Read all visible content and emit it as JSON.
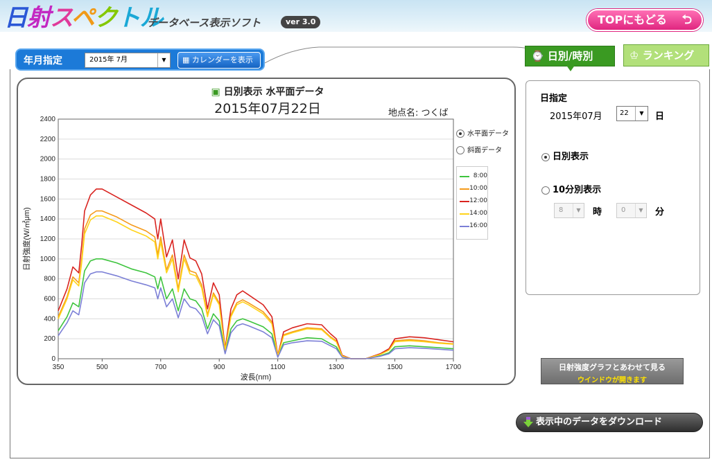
{
  "header": {
    "logo": [
      "日",
      "射",
      "ス",
      "ペ",
      "ク",
      "トル"
    ],
    "subtitle": "データベース表示ソフト",
    "version": "ver 3.0",
    "top_button": "TOPにもどる"
  },
  "year_month": {
    "label": "年月指定",
    "selected": "2015年 7月",
    "calendar_button": "カレンダーを表示"
  },
  "tabs": {
    "daily": "日別/時別",
    "ranking": "ランキング"
  },
  "chart_header": {
    "title": "日別表示 水平面データ",
    "date": "2015年07月22日",
    "location": "地点名: つくば"
  },
  "surface_options": {
    "horizontal": "水平面データ",
    "inclined": "斜面データ"
  },
  "right_panel": {
    "title": "日指定",
    "year_month": "2015年07月",
    "day_value": "22",
    "day_unit": "日",
    "daily_option": "日別表示",
    "ten_min_option": "10分別表示",
    "hour_value": "8",
    "hour_unit": "時",
    "minute_value": "0",
    "minute_unit": "分"
  },
  "buttons": {
    "combo_line1": "日射強度グラフとあわせて見る",
    "combo_line2": "ウインドウが開きます",
    "download": "表示中のデータをダウンロード"
  },
  "chart_data": {
    "type": "line",
    "xlabel": "波長(nm)",
    "ylabel": "日射強度(W/㎡μm)",
    "xlim": [
      350,
      1700
    ],
    "ylim": [
      0,
      2400
    ],
    "x_ticks": [
      350,
      500,
      700,
      900,
      1100,
      1300,
      1500,
      1700
    ],
    "y_ticks": [
      0,
      200,
      400,
      600,
      800,
      1000,
      1200,
      1400,
      1600,
      1800,
      2000,
      2200,
      2400
    ],
    "grid": "horizontal",
    "x": [
      350,
      380,
      400,
      420,
      430,
      440,
      460,
      480,
      500,
      550,
      600,
      650,
      680,
      690,
      700,
      720,
      740,
      760,
      780,
      800,
      820,
      840,
      860,
      880,
      900,
      920,
      940,
      960,
      980,
      1000,
      1050,
      1080,
      1100,
      1120,
      1150,
      1200,
      1250,
      1280,
      1300,
      1320,
      1350,
      1400,
      1450,
      1480,
      1500,
      1550,
      1600,
      1650,
      1700
    ],
    "series": [
      {
        "name": "8:00",
        "color": "#3dc43d",
        "values": [
          280,
          420,
          560,
          520,
          700,
          880,
          980,
          1000,
          1000,
          960,
          900,
          860,
          820,
          700,
          820,
          600,
          700,
          480,
          700,
          600,
          580,
          500,
          300,
          450,
          380,
          60,
          300,
          380,
          400,
          380,
          320,
          250,
          20,
          160,
          180,
          210,
          200,
          150,
          120,
          20,
          0,
          0,
          30,
          60,
          120,
          130,
          120,
          110,
          100
        ]
      },
      {
        "name": "10:00",
        "color": "#f59a1a",
        "values": [
          420,
          620,
          820,
          760,
          1000,
          1300,
          1440,
          1480,
          1480,
          1420,
          1340,
          1280,
          1220,
          1040,
          1220,
          890,
          1040,
          700,
          1040,
          880,
          860,
          740,
          440,
          660,
          560,
          90,
          440,
          560,
          590,
          560,
          470,
          370,
          30,
          240,
          270,
          310,
          300,
          220,
          180,
          30,
          0,
          0,
          45,
          90,
          180,
          190,
          180,
          160,
          150
        ]
      },
      {
        "name": "12:00",
        "color": "#d9231f",
        "values": [
          480,
          700,
          920,
          860,
          1140,
          1480,
          1640,
          1700,
          1700,
          1620,
          1540,
          1460,
          1400,
          1200,
          1400,
          1020,
          1190,
          800,
          1190,
          1010,
          980,
          850,
          500,
          760,
          640,
          100,
          500,
          640,
          680,
          640,
          540,
          420,
          35,
          270,
          310,
          350,
          340,
          250,
          200,
          35,
          0,
          0,
          50,
          100,
          200,
          220,
          210,
          190,
          170
        ]
      },
      {
        "name": "14:00",
        "color": "#ffd31a",
        "values": [
          400,
          600,
          790,
          730,
          960,
          1250,
          1390,
          1430,
          1430,
          1370,
          1290,
          1230,
          1170,
          1000,
          1170,
          860,
          1000,
          670,
          1000,
          850,
          830,
          710,
          420,
          640,
          540,
          85,
          420,
          540,
          570,
          540,
          450,
          350,
          28,
          230,
          260,
          300,
          290,
          210,
          170,
          28,
          0,
          0,
          42,
          85,
          170,
          180,
          170,
          155,
          145
        ]
      },
      {
        "name": "16:00",
        "color": "#7b7fd6",
        "values": [
          230,
          360,
          480,
          440,
          590,
          760,
          850,
          870,
          870,
          830,
          780,
          740,
          710,
          600,
          710,
          520,
          600,
          410,
          600,
          520,
          500,
          430,
          250,
          390,
          330,
          50,
          260,
          330,
          350,
          330,
          270,
          210,
          15,
          140,
          160,
          180,
          175,
          130,
          100,
          15,
          0,
          0,
          25,
          50,
          100,
          110,
          105,
          95,
          85
        ]
      }
    ]
  }
}
